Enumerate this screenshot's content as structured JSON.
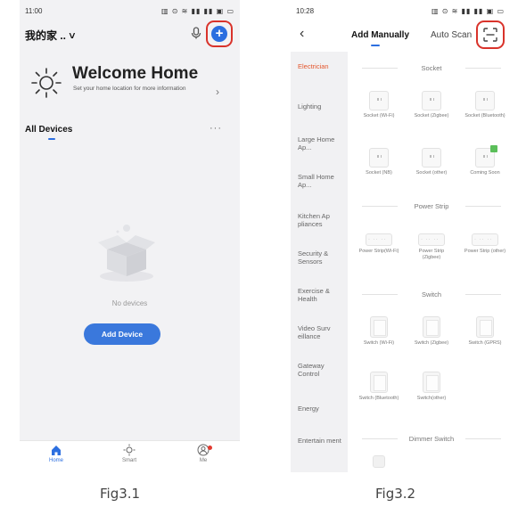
{
  "fig1": {
    "status": {
      "time": "11:00",
      "icons": "▥ ⊙ ≋ ▮▮ ▮▮ ▣ ▭"
    },
    "header": {
      "home_title": "我的家 .. ˅",
      "mic_icon": "microphone-icon",
      "add_icon": "plus-circle-icon",
      "add_glyph": "+"
    },
    "welcome": {
      "title": "Welcome Home",
      "subtitle": "Set your home location for more information",
      "arrow": "›"
    },
    "devices": {
      "heading": "All Devices",
      "more": "···"
    },
    "empty": {
      "text": "No devices",
      "button": "Add Device"
    },
    "tabbar": [
      {
        "label": "Home",
        "icon": "home-icon",
        "active": true
      },
      {
        "label": "Smart",
        "icon": "sun-icon",
        "active": false
      },
      {
        "label": "Me",
        "icon": "user-icon",
        "active": false
      }
    ],
    "caption": "Fig3.1"
  },
  "fig2": {
    "status": {
      "time": "10:28",
      "icons": "▥ ⊙ ≋ ▮▮ ▮▮ ▣ ▭"
    },
    "header": {
      "back": "‹",
      "tab_manual": "Add Manually",
      "tab_auto": "Auto Scan",
      "scan_icon": "scan-icon"
    },
    "sidebar": [
      "Electrician",
      "Lighting",
      "Large Home Ap...",
      "Small Home Ap...",
      "Kitchen Ap pliances",
      "Security & Sensors",
      "Exercise & Health",
      "Video Surv eillance",
      "Gateway Control",
      "Energy",
      "Entertain ment"
    ],
    "sections": {
      "socket": "Socket",
      "power_strip": "Power Strip",
      "switch": "Switch",
      "dimmer": "Dimmer Switch"
    },
    "devices": {
      "socket": [
        "Socket (Wi-Fi)",
        "Socket (Zigbee)",
        "Socket (Bluetooth)",
        "Socket (NB)",
        "Socket (other)",
        "Coming Soon"
      ],
      "strip": [
        "Power Strip(Wi-Fi)",
        "Power Strip (Zigbee)",
        "Power Strip (other)"
      ],
      "switch": [
        "Switch (Wi-Fi)",
        "Switch (Zigbee)",
        "Switch (GPRS)",
        "Switch (Bluetooth)",
        "Switch(other)"
      ]
    },
    "caption": "Fig3.2"
  },
  "colors": {
    "accent": "#2c6fe0",
    "highlight": "#d9332b",
    "active_category": "#e4572e",
    "coming_soon_badge": "#5bbf5a"
  }
}
